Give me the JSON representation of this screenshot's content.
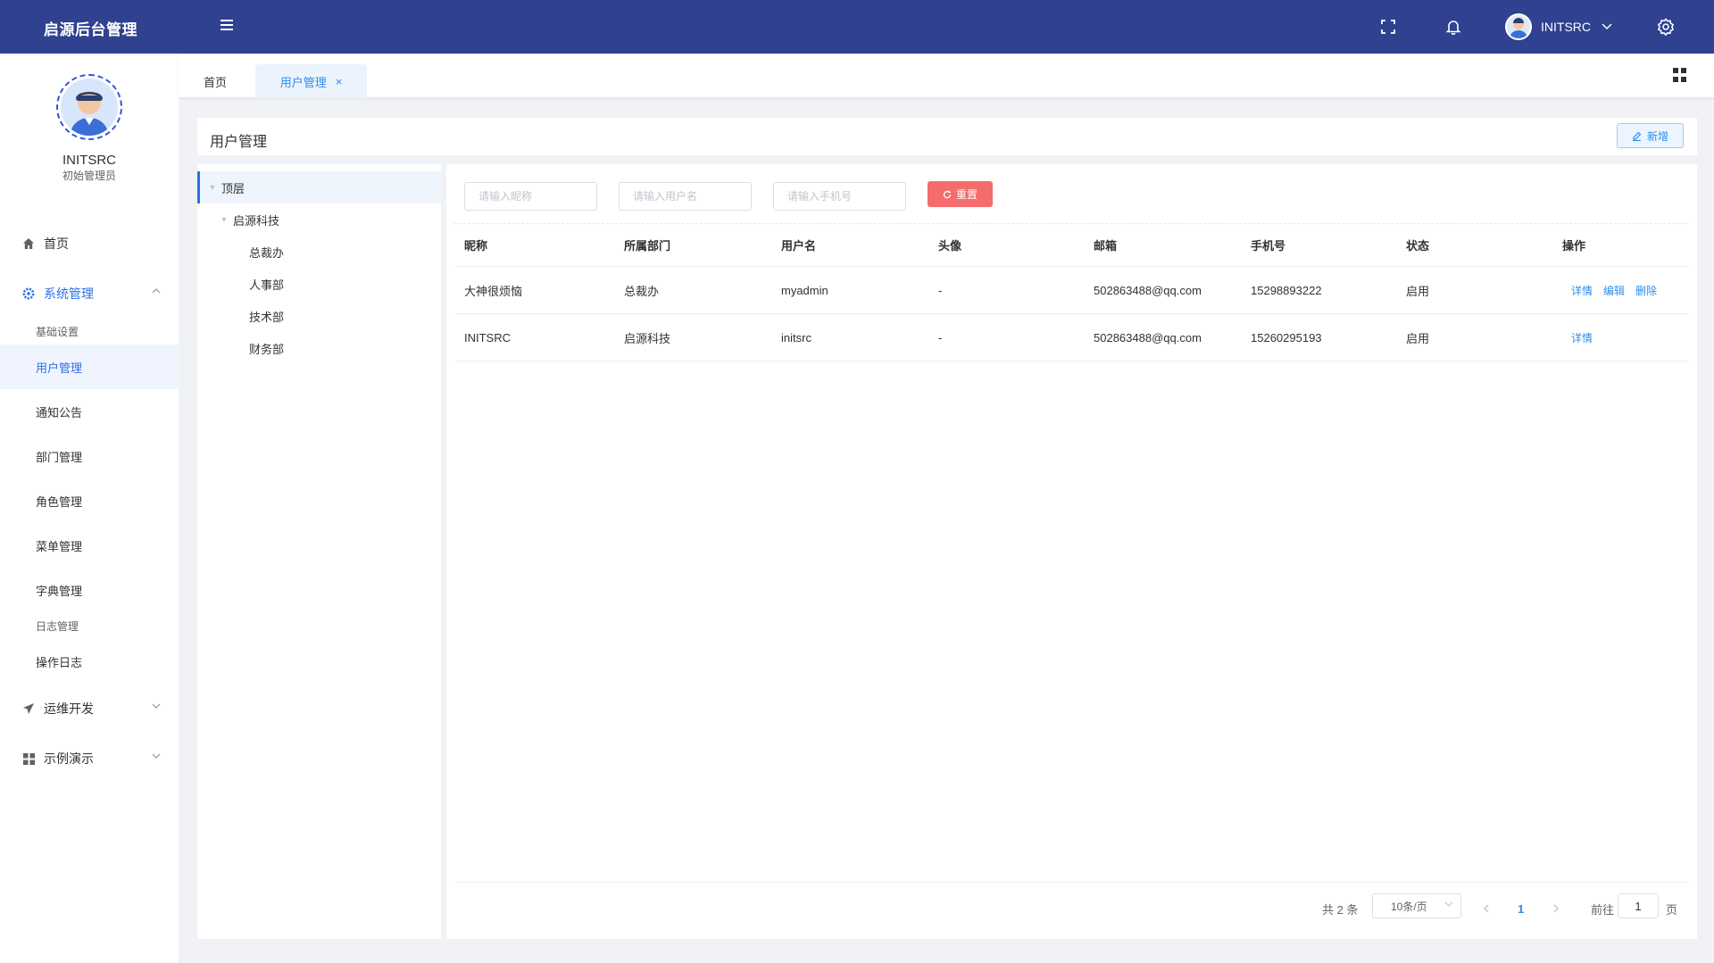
{
  "header": {
    "app_title": "启源后台管理",
    "user_name": "INITSRC"
  },
  "sidebar": {
    "profile": {
      "name": "INITSRC",
      "role": "初始管理员"
    },
    "home": "首页",
    "system": {
      "label": "系统管理",
      "items": [
        "基础设置",
        "用户管理",
        "通知公告",
        "部门管理",
        "角色管理",
        "菜单管理",
        "字典管理",
        "日志管理",
        "操作日志"
      ]
    },
    "devops": "运维开发",
    "demo": "示例演示"
  },
  "tabs": {
    "home": "首页",
    "active": "用户管理",
    "close": "×"
  },
  "page": {
    "title": "用户管理",
    "add_label": "新增"
  },
  "tree": {
    "root": "顶层",
    "company": "启源科技",
    "departments": [
      "总裁办",
      "人事部",
      "技术部",
      "财务部"
    ]
  },
  "search": {
    "nickname_placeholder": "请输入昵称",
    "username_placeholder": "请输入用户名",
    "phone_placeholder": "请输入手机号",
    "reset_label": "重置"
  },
  "table": {
    "columns": [
      "昵称",
      "所属部门",
      "用户名",
      "头像",
      "邮箱",
      "手机号",
      "状态",
      "操作"
    ],
    "rows": [
      {
        "nickname": "大神很烦恼",
        "dept": "总裁办",
        "username": "myadmin",
        "avatar": "-",
        "email": "502863488@qq.com",
        "phone": "15298893222",
        "status": "启用",
        "ops": [
          "详情",
          "编辑",
          "删除"
        ]
      },
      {
        "nickname": "INITSRC",
        "dept": "启源科技",
        "username": "initsrc",
        "avatar": "-",
        "email": "502863488@qq.com",
        "phone": "15260295193",
        "status": "启用",
        "ops": [
          "详情"
        ]
      }
    ]
  },
  "pagination": {
    "total_text": "共 2 条",
    "page_size": "10条/页",
    "current_page": "1",
    "goto_label": "前往",
    "goto_value": "1",
    "page_unit": "页"
  },
  "colors": {
    "header_bg": "#304190",
    "accent": "#2d8cf0",
    "danger": "#f56c6c"
  }
}
